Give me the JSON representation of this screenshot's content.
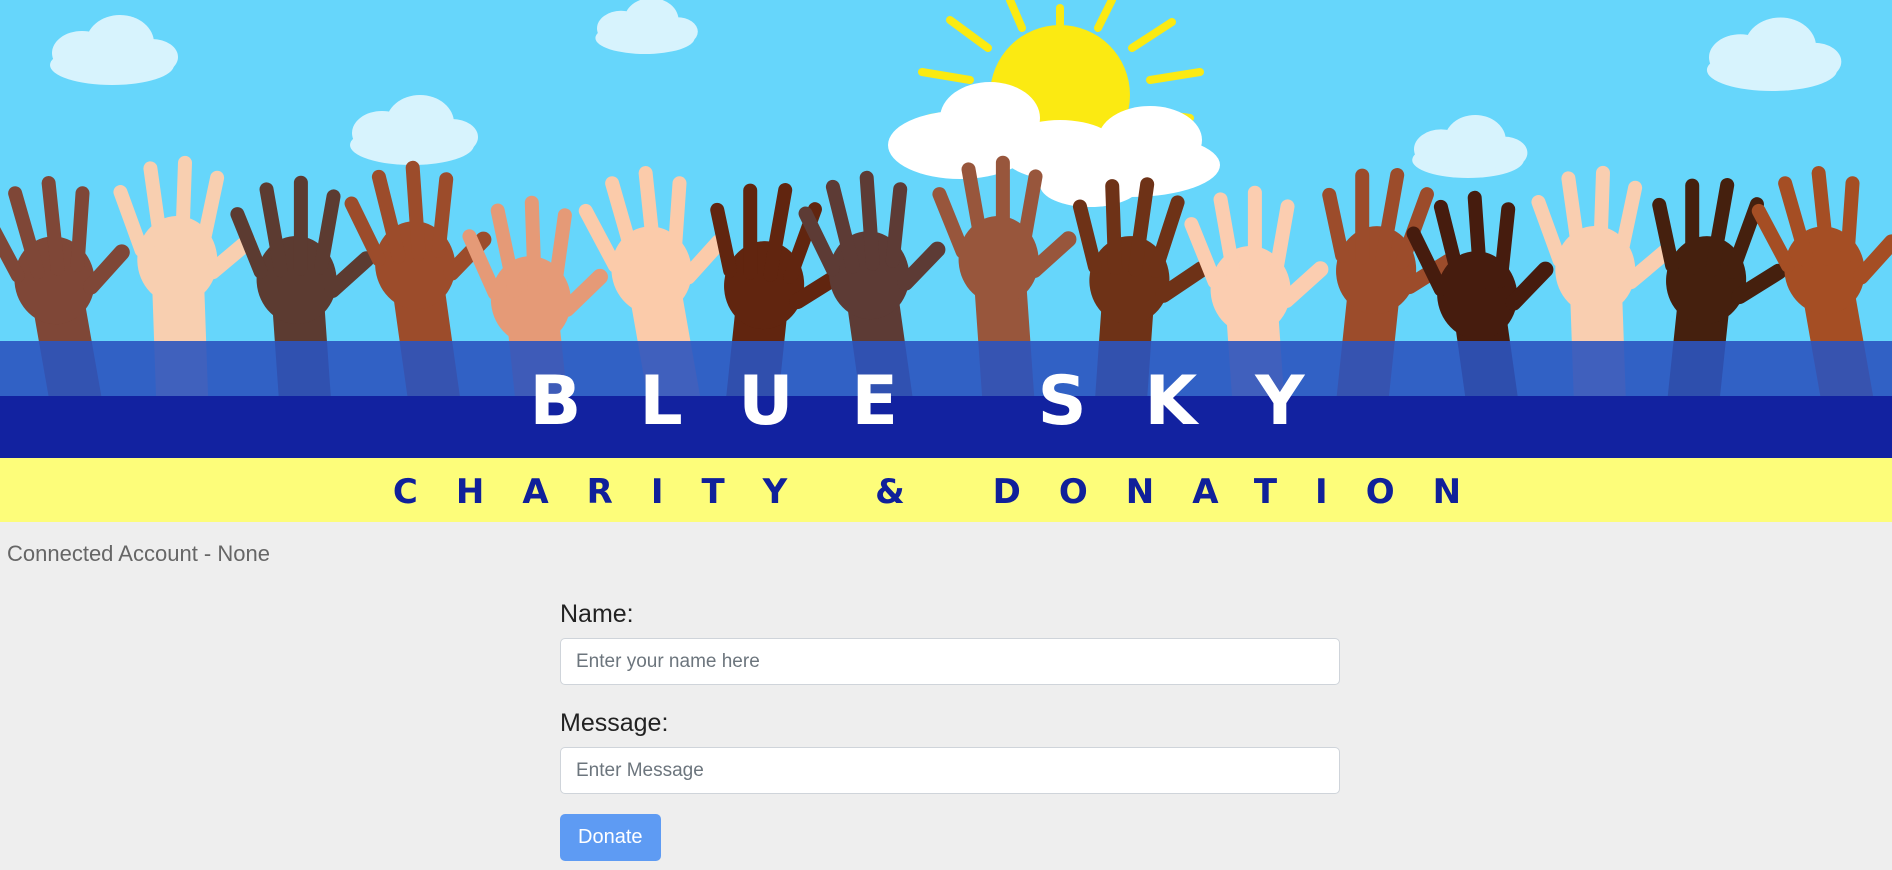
{
  "banner": {
    "title": "BLUE SKY",
    "subtitle": "CHARITY & DONATION",
    "colors": {
      "sky": "#66d6fb",
      "band_light": "#2b54bf",
      "band_dark": "#1222a0",
      "strip": "#fdfd7a",
      "subtitle_text": "#10209a",
      "sun": "#fbea12"
    }
  },
  "account": {
    "status_text": "Connected Account - None"
  },
  "form": {
    "name_label": "Name:",
    "name_placeholder": "Enter your name here",
    "message_label": "Message:",
    "message_placeholder": "Enter Message",
    "donate_label": "Donate"
  }
}
